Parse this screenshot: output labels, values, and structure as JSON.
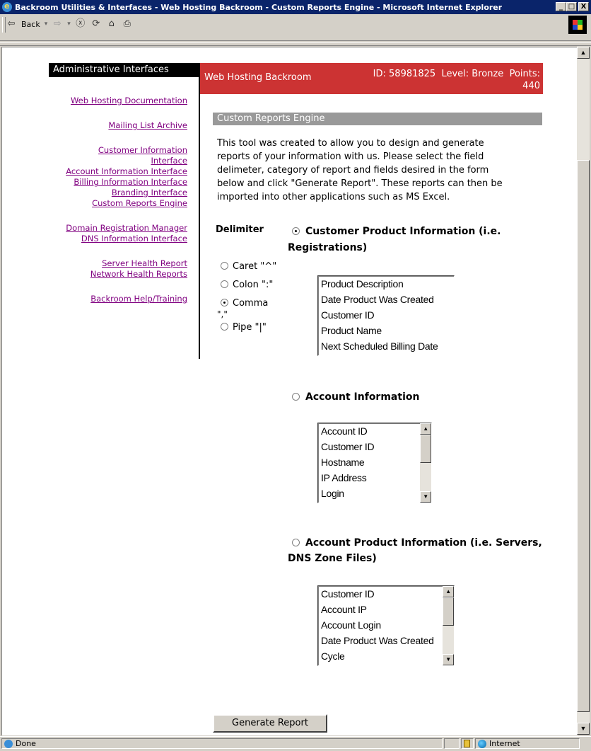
{
  "window": {
    "title": "Backroom Utilities & Interfaces - Web Hosting Backroom - Custom Reports Engine - Microsoft Internet Explorer",
    "controls": {
      "minimize": "_",
      "maximize": "□",
      "close": "X"
    }
  },
  "toolbar": {
    "back_label": "Back",
    "icons": [
      "back-arrow-icon",
      "forward-arrow-icon",
      "stop-icon",
      "refresh-icon",
      "home-icon",
      "print-icon"
    ]
  },
  "sidebar": {
    "header": "Administrative Interfaces",
    "groups": [
      [
        "Web Hosting Documentation"
      ],
      [
        "Mailing List Archive"
      ],
      [
        "Customer Information Interface",
        "Account Information Interface",
        "Billing Information Interface",
        "Branding Interface",
        "Custom Reports Engine"
      ],
      [
        "Domain Registration Manager",
        "DNS Information Interface"
      ],
      [
        "Server Health Report",
        "Network Health Reports"
      ],
      [
        "Backroom Help/Training"
      ]
    ]
  },
  "header": {
    "site_name": "Web Hosting Backroom",
    "id_text": "ID: 58981825",
    "level_text": "Level: Bronze",
    "points_label": "Points:",
    "points_value": "440"
  },
  "main": {
    "section_title": "Custom Reports Engine",
    "intro_text": "This tool was created to allow you to design and generate reports of your information with us. Please select the field delimeter, category of report and fields desired in the form below and click \"Generate Report\". These reports can then be imported into other applications such as MS Excel.",
    "delimiter_label": "Delimiter",
    "delimiters": [
      {
        "label": "Caret \"^\"",
        "selected": false
      },
      {
        "label": "Colon \":\"",
        "selected": false
      },
      {
        "label": "Comma",
        "suffix": "\",\"",
        "selected": true
      },
      {
        "label": "Pipe \"|\"",
        "selected": false
      }
    ],
    "categories": [
      {
        "line1": "Customer Product Information (i.e.",
        "line2": "Registrations)",
        "selected": true,
        "fields": [
          "Product Description",
          "Date Product Was Created",
          "Customer ID",
          "Product Name",
          "Next Scheduled Billing Date"
        ]
      },
      {
        "line1": "Account Information",
        "line2": "",
        "selected": false,
        "fields": [
          "Account ID",
          "Customer ID",
          "Hostname",
          "IP Address",
          "Login"
        ]
      },
      {
        "line1": "Account Product Information (i.e. Servers,",
        "line2": "DNS Zone Files)",
        "selected": false,
        "fields": [
          "Customer ID",
          "Account IP",
          "Account Login",
          "Date Product Was Created",
          "Cycle"
        ]
      }
    ],
    "generate_button": "Generate Report"
  },
  "status": {
    "text": "Done",
    "zone": "Internet"
  }
}
